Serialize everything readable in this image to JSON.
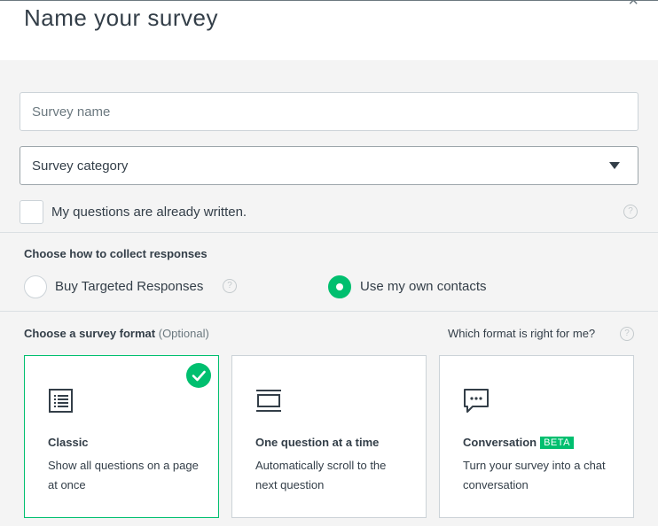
{
  "header": {
    "title": "Name your survey",
    "close_glyph": "×"
  },
  "form": {
    "survey_name": {
      "value": "",
      "placeholder": "Survey name"
    },
    "survey_category": {
      "selected": "Survey category"
    },
    "questions_written": {
      "label": "My questions are already written.",
      "checked": false
    }
  },
  "collect": {
    "heading": "Choose how to collect responses",
    "options": [
      {
        "label": "Buy Targeted Responses",
        "selected": false
      },
      {
        "label": "Use my own contacts",
        "selected": true
      }
    ]
  },
  "format": {
    "heading": "Choose a survey format",
    "optional": "(Optional)",
    "help_link": "Which format is right for me?",
    "cards": [
      {
        "title": "Classic",
        "description": "Show all questions on a page at once",
        "icon": "list-document-icon",
        "selected": true
      },
      {
        "title": "One question at a time",
        "description": "Automatically scroll to the next question",
        "icon": "scroll-frame-icon",
        "selected": false
      },
      {
        "title": "Conversation",
        "badge": "BETA",
        "description": "Turn your survey into a chat conversation",
        "icon": "chat-bubble-icon",
        "selected": false
      }
    ]
  },
  "colors": {
    "accent": "#00bf6f",
    "text": "#333e48",
    "muted": "#6b787f",
    "panel_bg": "#f4f4f4"
  }
}
